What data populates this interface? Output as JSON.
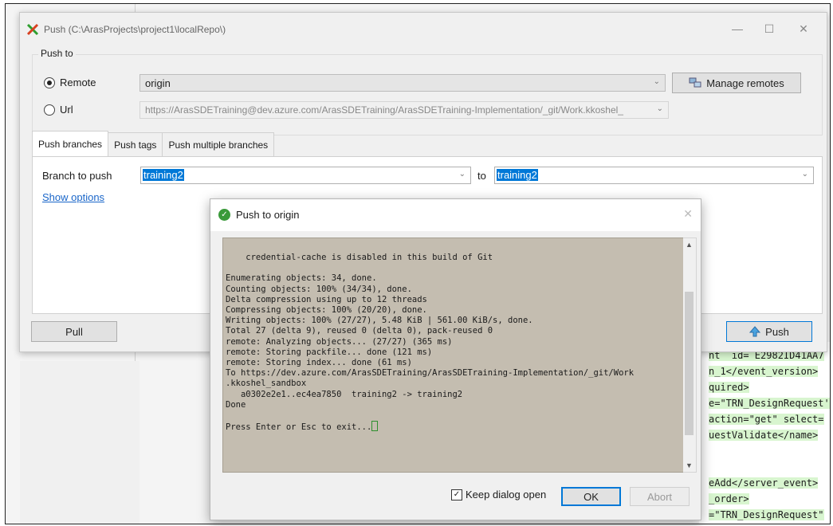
{
  "window": {
    "title": "Push (C:\\ArasProjects\\project1\\localRepo\\)",
    "minimize": "—",
    "maximize": "☐",
    "close": "✕"
  },
  "push_to": {
    "group_label": "Push to",
    "remote_label": "Remote",
    "remote_selected": true,
    "remote_value": "origin",
    "url_label": "Url",
    "url_value": "https://ArasSDETraining@dev.azure.com/ArasSDETraining/ArasSDETraining-Implementation/_git/Work.kkoshel_",
    "manage_remotes": "Manage remotes"
  },
  "tabs": [
    "Push branches",
    "Push tags",
    "Push multiple branches"
  ],
  "branches": {
    "branch_label": "Branch to push",
    "branch_value": "training2",
    "to_label": "to",
    "target_value": "training2",
    "show_options": "Show options"
  },
  "buttons": {
    "pull": "Pull",
    "push": "Push"
  },
  "dialog": {
    "title": "Push to origin",
    "close": "✕",
    "output": "    credential-cache is disabled in this build of Git\n\nEnumerating objects: 34, done.\nCounting objects: 100% (34/34), done.\nDelta compression using up to 12 threads\nCompressing objects: 100% (20/20), done.\nWriting objects: 100% (27/27), 5.48 KiB | 561.00 KiB/s, done.\nTotal 27 (delta 9), reused 0 (delta 0), pack-reused 0\nremote: Analyzing objects... (27/27) (365 ms)\nremote: Storing packfile... done (121 ms)\nremote: Storing index... done (61 ms)\nTo https://dev.azure.com/ArasSDETraining/ArasSDETraining-Implementation/_git/Work\n.kkoshel_sandbox\n   a0302e2e1..ec4ea7850  training2 -> training2\nDone\n\nPress Enter or Esc to exit...",
    "keep_open_label": "Keep dialog open",
    "keep_open_checked": true,
    "ok": "OK",
    "abort": "Abort"
  },
  "background_code": [
    "nt  id= E2982ID41AA7",
    "n_1</event_version>",
    "quired>",
    "e=\"TRN_DesignRequest'",
    "action=\"get\" select=",
    "uestValidate</name>",
    "",
    "",
    "eAdd</server_event>",
    "_order>",
    "=\"TRN_DesignRequest\""
  ],
  "colors": {
    "selection": "#0078d7",
    "console_bg": "#c4bdb0",
    "ok_border": "#0078d7",
    "code_highlight": "#d8f5cf"
  }
}
